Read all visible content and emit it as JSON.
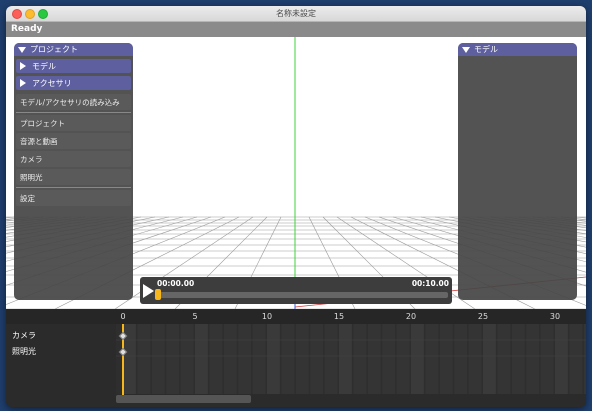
{
  "window": {
    "title": "名称未設定"
  },
  "status": {
    "text": "Ready"
  },
  "left_panel": {
    "header": "プロジェクト",
    "sub_items": [
      "モデル",
      "アクセサリ"
    ],
    "load_button": "モデル/アクセサリの読み込み",
    "buttons": [
      "プロジェクト",
      "音源と動画",
      "カメラ",
      "照明光",
      "設定"
    ]
  },
  "right_panel": {
    "header": "モデル"
  },
  "transport": {
    "start_time": "00:00.00",
    "end_time": "00:10.00",
    "progress": 0.0
  },
  "timeline": {
    "ticks": [
      "0",
      "5",
      "10",
      "15",
      "20",
      "25",
      "30"
    ],
    "tracks": [
      "カメラ",
      "照明光"
    ]
  },
  "colors": {
    "accent": "#5d5f9e",
    "playhead": "#f5b71b",
    "axis_y": "#3fd33f",
    "axis_x": "#d33f3f"
  }
}
